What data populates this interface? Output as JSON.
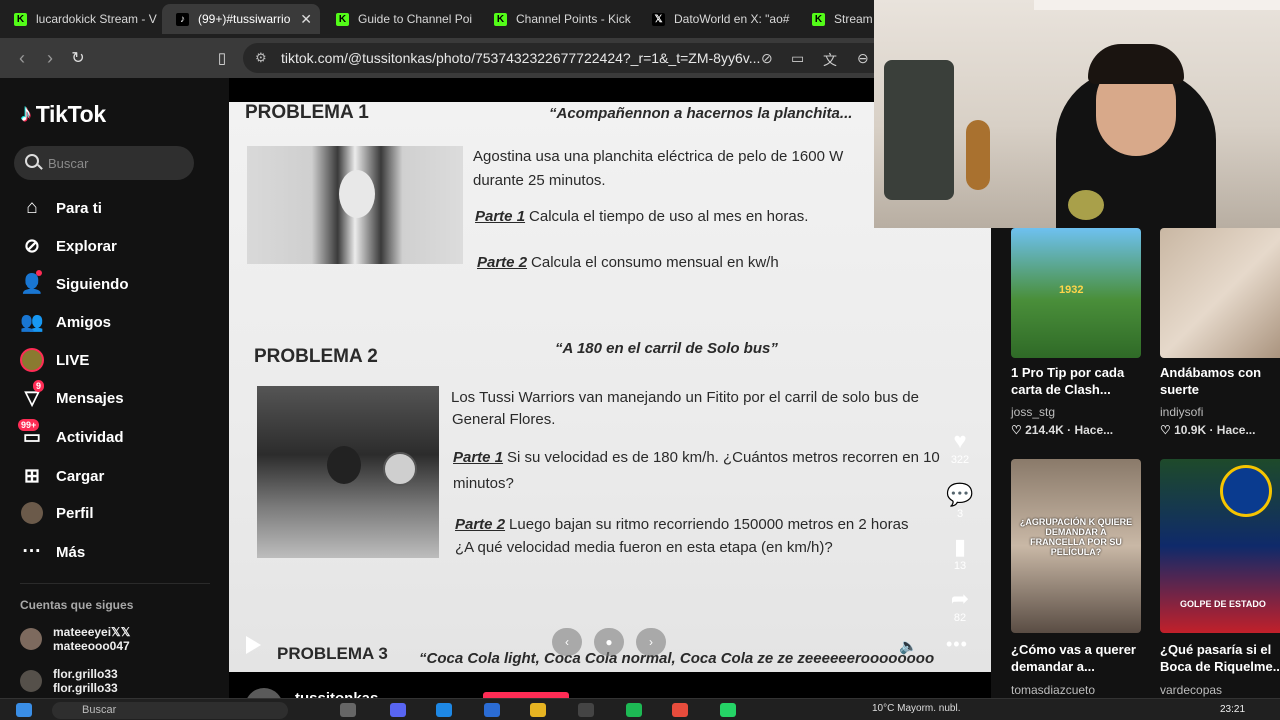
{
  "browser": {
    "tabs": [
      {
        "label": "lucardokick Stream - V",
        "icon": "kick-favicon"
      },
      {
        "label": "(99+)#tussiwarrio",
        "icon": "tiktok-favicon",
        "active": true
      },
      {
        "label": "Guide to Channel Poi",
        "icon": "kick-favicon"
      },
      {
        "label": "Channel Points - Kick",
        "icon": "kick-favicon"
      },
      {
        "label": "DatoWorld en X: \"ao#",
        "icon": "x-favicon"
      },
      {
        "label": "Stream -",
        "icon": "kick-favicon"
      }
    ],
    "tab_close": "✕",
    "url": "tiktok.com/@tussitonkas/photo/7537432322677722424?_r=1&_t=ZM-8yy6v..."
  },
  "sidebar": {
    "logo": "TikTok",
    "search_placeholder": "Buscar",
    "nav": [
      {
        "label": "Para ti",
        "icon": "home-icon"
      },
      {
        "label": "Explorar",
        "icon": "compass-icon"
      },
      {
        "label": "Siguiendo",
        "icon": "following-icon"
      },
      {
        "label": "Amigos",
        "icon": "friends-icon"
      },
      {
        "label": "LIVE",
        "icon": "live-icon"
      },
      {
        "label": "Mensajes",
        "icon": "messages-icon",
        "badge": "9"
      },
      {
        "label": "Actividad",
        "icon": "activity-icon",
        "badge": "99+"
      },
      {
        "label": "Cargar",
        "icon": "upload-icon"
      },
      {
        "label": "Perfil",
        "icon": "profile-avatar"
      },
      {
        "label": "Más",
        "icon": "more-icon"
      }
    ],
    "following_title": "Cuentas que sigues",
    "following": [
      {
        "name": "mateeeyei𝕏𝕏",
        "handle": "mateeooo047"
      },
      {
        "name": "flor.grillo33",
        "handle": "flor.grillo33"
      }
    ]
  },
  "post": {
    "problem1": {
      "heading": "PROBLEMA 1",
      "subtitle": "“Acompañennon a hacernos la planchita...",
      "text": "Agostina usa una planchita eléctrica de pelo de 1600 W",
      "text2": "durante 25 minutos.",
      "parte1_label": "Parte 1",
      "parte1": "Calcula el tiempo de uso al mes en horas.",
      "parte2_label": "Parte 2",
      "parte2": "Calcula el consumo mensual en kw/h"
    },
    "problem2": {
      "heading": "PROBLEMA 2",
      "subtitle": "“A 180 en el carril de Solo bus”",
      "text": "Los Tussi Warriors van manejando un Fitito por el carril de solo bus de",
      "text2": "General Flores.",
      "parte1_label": "Parte 1",
      "parte1": "Si su velocidad es de 180 km/h. ¿Cuántos metros recorren en 10",
      "parte1b": "minutos?",
      "parte2_label": "Parte 2",
      "parte2": "Luego bajan su ritmo recorriendo 150000 metros en 2 horas",
      "parte2b": "¿A qué velocidad media  fueron en esta etapa (en km/h)?"
    },
    "problem3": {
      "heading": "PROBLEMA 3",
      "subtitle": "“Coca Cola light, Coca Cola normal, Coca Cola ze ze zeeeeeeroooooooo"
    },
    "actions": {
      "likes": "322",
      "comments": "3",
      "saves": "13",
      "shares": "82"
    },
    "author": "tussitonkas"
  },
  "explore": [
    {
      "title": "1 Pro Tip por cada carta de Clash...",
      "user": "joss_stg",
      "stats": "214.4K · Hace...",
      "thumb_text": "1932"
    },
    {
      "title": "Andábamos con suerte",
      "user": "indiysofi",
      "stats": "10.9K · Hace..."
    },
    {
      "title": "¿Cómo vas a querer demandar a...",
      "user": "tomasdiazcueto",
      "stats": "",
      "thumb_text": "¿AGRUPACIÓN K QUIERE DEMANDAR A FRANCELLA POR SU PELÍCULA?"
    },
    {
      "title": "¿Qué pasaría si el Boca de Riquelme...",
      "user": "vardecopas",
      "stats": "",
      "thumb_text": "GOLPE DE ESTADO"
    }
  ],
  "taskbar": {
    "search": "Buscar",
    "weather": "10°C  Mayorm. nubl.",
    "time": "23:21"
  },
  "colors": {
    "accent": "#fe2c55",
    "kick": "#53fc18",
    "sidebar_bg": "#121212"
  }
}
